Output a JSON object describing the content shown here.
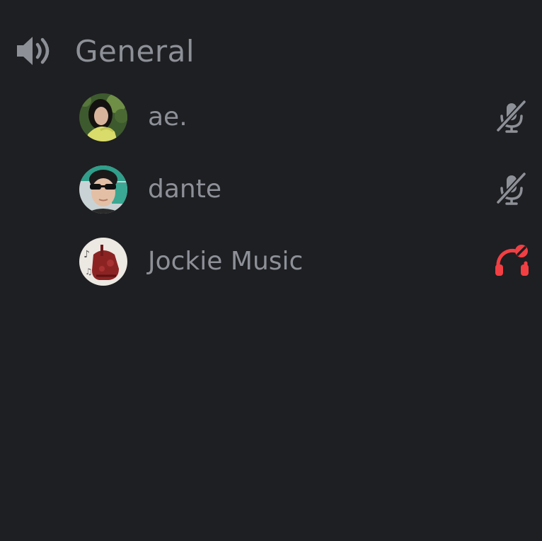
{
  "channel": {
    "name": "General",
    "icon": "speaker-icon"
  },
  "users": [
    {
      "name": "ae.",
      "status_icon": "microphone-muted-icon",
      "status_color": "#8e9098"
    },
    {
      "name": "dante",
      "status_icon": "microphone-muted-icon",
      "status_color": "#8e9098"
    },
    {
      "name": "Jockie Music",
      "status_icon": "headphones-deafened-icon",
      "status_color": "#f23f43"
    }
  ],
  "colors": {
    "background": "#1e1f22",
    "text": "#8e9098",
    "danger": "#f23f43"
  }
}
